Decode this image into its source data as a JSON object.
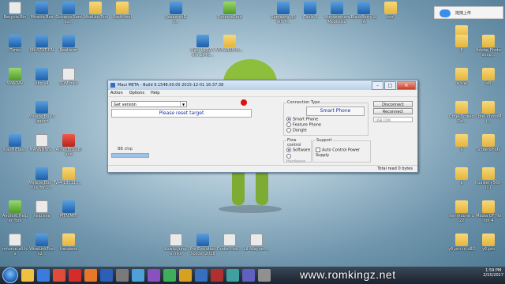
{
  "desktop": {
    "icons": [
      {
        "label": "Recycle Bin",
        "x": 0,
        "y": 0,
        "type": "exe"
      },
      {
        "label": "Miracle Box",
        "x": 1,
        "y": 0,
        "type": "app"
      },
      {
        "label": "Octopus Samsu...",
        "x": 2,
        "y": 0,
        "type": "app"
      },
      {
        "label": "WiseLinkTool",
        "x": 3,
        "y": 0,
        "type": "folder"
      },
      {
        "label": "flash_tool",
        "x": 4,
        "y": 0,
        "type": "folder"
      },
      {
        "label": "ResearchDo...",
        "x": 6,
        "y": 0,
        "type": "app"
      },
      {
        "label": "PhoenixCard",
        "x": 8,
        "y": 0,
        "type": "green"
      },
      {
        "label": "Samsung 30W0 T...",
        "x": 10,
        "y": 0,
        "type": "app"
      },
      {
        "label": "iTools 3",
        "x": 11,
        "y": 0,
        "type": "app"
      },
      {
        "label": "Wondershare MobileGo",
        "x": 12,
        "y": 0,
        "type": "app"
      },
      {
        "label": "BlackBerry Link",
        "x": 13,
        "y": 0,
        "type": "app"
      },
      {
        "label": "tool",
        "x": 14,
        "y": 0,
        "type": "folder"
      },
      {
        "label": "iTunes",
        "x": 0,
        "y": 1,
        "type": "app"
      },
      {
        "label": "SN_STATION",
        "x": 1,
        "y": 1,
        "type": "app"
      },
      {
        "label": "Realterm",
        "x": 2,
        "y": 1,
        "type": "app"
      },
      {
        "label": "Maui META ver9.1548...",
        "x": 7,
        "y": 1,
        "type": "app"
      },
      {
        "label": "W4-A368 l3...",
        "x": 8,
        "y": 1,
        "type": "folder"
      },
      {
        "label": "SMADAV",
        "x": 0,
        "y": 2,
        "type": "green"
      },
      {
        "label": "xbo v4",
        "x": 1,
        "y": 2,
        "type": "app"
      },
      {
        "label": "3DM.mkv",
        "x": 2,
        "y": 2,
        "type": "exe"
      },
      {
        "label": "Miracle Box Support",
        "x": 1,
        "y": 3,
        "type": "app"
      },
      {
        "label": "XiaoMiFlas...",
        "x": 0,
        "y": 4,
        "type": "app"
      },
      {
        "label": "MANNNNN...",
        "x": 1,
        "y": 4,
        "type": "exe"
      },
      {
        "label": "Airtel Broadband",
        "x": 2,
        "y": 4,
        "type": "red"
      },
      {
        "label": "Miracle Box Truly for C...",
        "x": 1,
        "y": 5,
        "type": "app"
      },
      {
        "label": "W4-180110...",
        "x": 2,
        "y": 5,
        "type": "folder"
      },
      {
        "label": "Android Helper Tool",
        "x": 0,
        "y": 6,
        "type": "green"
      },
      {
        "label": "help.exe",
        "x": 1,
        "y": 6,
        "type": "exe"
      },
      {
        "label": "MTN MiFi",
        "x": 2,
        "y": 6,
        "type": "app"
      },
      {
        "label": "mhome all.fcs",
        "x": 0,
        "y": 7,
        "type": "exe"
      },
      {
        "label": "WiseLinkTool v2...",
        "x": 1,
        "y": 7,
        "type": "app"
      },
      {
        "label": "frandeno",
        "x": 2,
        "y": 7,
        "type": "folder"
      },
      {
        "label": "Kuwtu Jungle.mkv",
        "x": 6,
        "y": 7,
        "type": "exe"
      },
      {
        "label": "Pro Evolution Soccer 2018",
        "x": 7,
        "y": 7,
        "type": "app"
      },
      {
        "label": "Drake_Hotl...",
        "x": 8,
        "y": 7,
        "type": "exe"
      },
      {
        "label": "Lil_Wayne_...",
        "x": 9,
        "y": 7,
        "type": "exe"
      }
    ],
    "right_icons": [
      {
        "label": "PSP",
        "row": 0
      },
      {
        "label": "8",
        "row": 1
      },
      {
        "label": "Adobe Photoshop...",
        "row": 1
      },
      {
        "label": "...",
        "row": 1
      },
      {
        "label": "a.v.w",
        "row": 2
      },
      {
        "label": "a8",
        "row": 2
      },
      {
        "label": "Corel ScreenCa...",
        "row": 3
      },
      {
        "label": "Corel PhotoMi...",
        "row": 3
      },
      {
        "label": "a",
        "row": 4
      },
      {
        "label": "Screenshots",
        "row": 4
      },
      {
        "label": "a",
        "row": 5
      },
      {
        "label": "huawei y560-l01",
        "row": 5
      },
      {
        "label": "ilerimuone u22",
        "row": 6
      },
      {
        "label": "Media OF Honor 4",
        "row": 6
      },
      {
        "label": "y6 pro tn u82",
        "row": 7
      },
      {
        "label": "y6 pro",
        "row": 7
      }
    ]
  },
  "window": {
    "title": "Maui META - Build 9.1548.00.00 2015-12-01 16:37:38",
    "menu": [
      "Action",
      "Options",
      "Help"
    ],
    "combo_value": "Get version",
    "message": "Please reset target",
    "bb_label": "BB chip",
    "connection": {
      "legend": "Connection Type",
      "mode": "Smart Phone",
      "options": [
        "Smart Phone",
        "Feature Phone",
        "Dongle"
      ],
      "selected": 0
    },
    "buttons": {
      "disconnect": "Disconnect",
      "reconnect": "Reconnect"
    },
    "port": "USB COM",
    "flow": {
      "legend": "Flow control",
      "options": [
        "Software",
        "Hardware"
      ],
      "selected": 0
    },
    "support": {
      "legend": "Support",
      "option": "Auto Control Power Supply"
    },
    "status": "Total read 0 bytes"
  },
  "top_widget": {
    "label": "拖拽上传"
  },
  "watermark": "www.romkingz.net",
  "taskbar": {
    "time": "1:59 PM",
    "date": "2/15/2017",
    "apps": [
      "explorer",
      "media",
      "chrome",
      "opera",
      "firefox",
      "word",
      "settings",
      "app1",
      "app2",
      "app3",
      "app4",
      "app5",
      "app6",
      "app7",
      "app8",
      "app9"
    ]
  }
}
